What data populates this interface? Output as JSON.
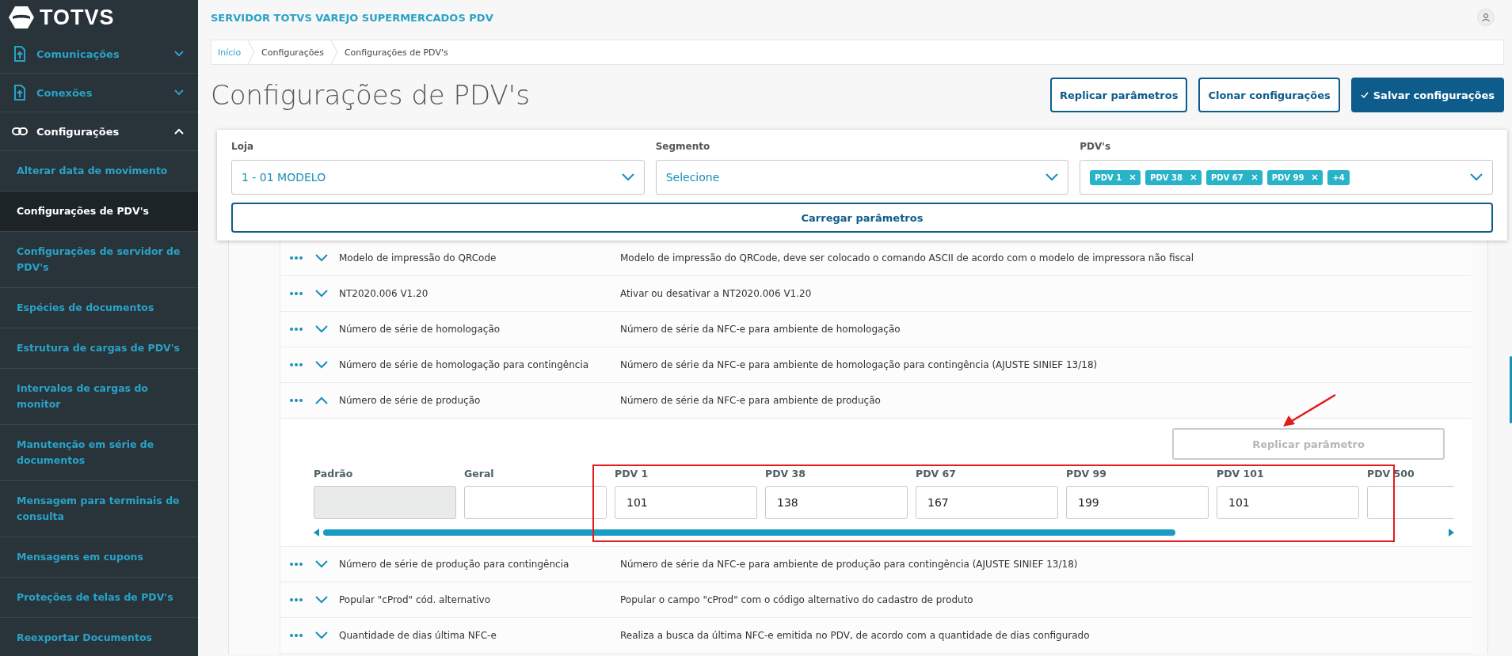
{
  "brand": "TOTVS",
  "sidebar": {
    "items": [
      {
        "label": "Comunicações",
        "expanded": false
      },
      {
        "label": "Conexões",
        "expanded": false
      },
      {
        "label": "Configurações",
        "expanded": true,
        "children": [
          {
            "label": "Alterar data de movimento",
            "selected": false
          },
          {
            "label": "Configurações de PDV's",
            "selected": true
          },
          {
            "label": "Configurações de servidor de PDV's",
            "selected": false
          },
          {
            "label": "Espécies de documentos",
            "selected": false
          },
          {
            "label": "Estrutura de cargas de PDV's",
            "selected": false
          },
          {
            "label": "Intervalos de cargas do monitor",
            "selected": false
          },
          {
            "label": "Manutenção em série de documentos",
            "selected": false
          },
          {
            "label": "Mensagem para terminais de consulta",
            "selected": false
          },
          {
            "label": "Mensagens em cupons",
            "selected": false
          },
          {
            "label": "Proteções de telas de PDV's",
            "selected": false
          },
          {
            "label": "Reexportar Documentos",
            "selected": false
          }
        ]
      }
    ]
  },
  "header": {
    "title": "SERVIDOR TOTVS VAREJO SUPERMERCADOS PDV"
  },
  "breadcrumb": [
    {
      "label": "Início",
      "link": true
    },
    {
      "label": "Configurações",
      "link": false
    },
    {
      "label": "Configurações de PDV's",
      "link": false
    }
  ],
  "page_title": "Configurações de PDV's",
  "actions": [
    {
      "label": "Replicar parâmetros",
      "kind": "outline"
    },
    {
      "label": "Clonar configurações",
      "kind": "outline"
    },
    {
      "label": "Salvar configurações",
      "kind": "primary"
    }
  ],
  "filters": {
    "loja": {
      "label": "Loja",
      "value": "1 - 01 MODELO"
    },
    "segmento": {
      "label": "Segmento",
      "value": "Selecione"
    },
    "pdvs": {
      "label": "PDV's",
      "tags": [
        "PDV 1",
        "PDV 38",
        "PDV 67",
        "PDV 99"
      ],
      "more": "+4"
    },
    "load_button": "Carregar parâmetros"
  },
  "parameters": [
    {
      "name": "Modelo de impressão do QRCode",
      "description": "Modelo de impressão do QRCode, deve ser colocado o comando ASCII de acordo com o modelo de impressora não fiscal",
      "expanded": false
    },
    {
      "name": "NT2020.006 V1.20",
      "description": "Ativar ou desativar a NT2020.006 V1.20",
      "expanded": false
    },
    {
      "name": "Número de série de homologação",
      "description": "Número de série da NFC-e para ambiente de homologação",
      "expanded": false
    },
    {
      "name": "Número de série de homologação para contingência",
      "description": "Número de série da NFC-e para ambiente de homologação para contingência (AJUSTE SINIEF 13/18)",
      "expanded": false
    },
    {
      "name": "Número de série de produção",
      "description": "Número de série da NFC-e para ambiente de produção",
      "expanded": true,
      "detail": {
        "replicate_button": {
          "label": "Replicar parâmetro",
          "disabled": true
        },
        "columns": [
          {
            "label": "Padrão",
            "disabled": true
          },
          {
            "label": "Geral",
            "disabled": false
          },
          {
            "label": "PDV 1",
            "value": "101",
            "disabled": false
          },
          {
            "label": "PDV 38",
            "value": "138",
            "disabled": false
          },
          {
            "label": "PDV 67",
            "value": "167",
            "disabled": false
          },
          {
            "label": "PDV 99",
            "value": "199",
            "disabled": false
          },
          {
            "label": "PDV 101",
            "value": "101",
            "disabled": false
          },
          {
            "label": "PDV 500",
            "disabled": false
          }
        ]
      }
    },
    {
      "name": "Número de série de produção para contingência",
      "description": "Número de série da NFC-e para ambiente de produção para contingência (AJUSTE SINIEF 13/18)",
      "expanded": false
    },
    {
      "name": "Popular \"cProd\" cód. alternativo",
      "description": "Popular o campo \"cProd\" com o código alternativo do cadastro de produto",
      "expanded": false
    },
    {
      "name": "Quantidade de dias última NFC-e",
      "description": "Realiza a busca da última NFC-e emitida no PDV, de acordo com a quantidade de dias configurado",
      "expanded": false
    }
  ]
}
